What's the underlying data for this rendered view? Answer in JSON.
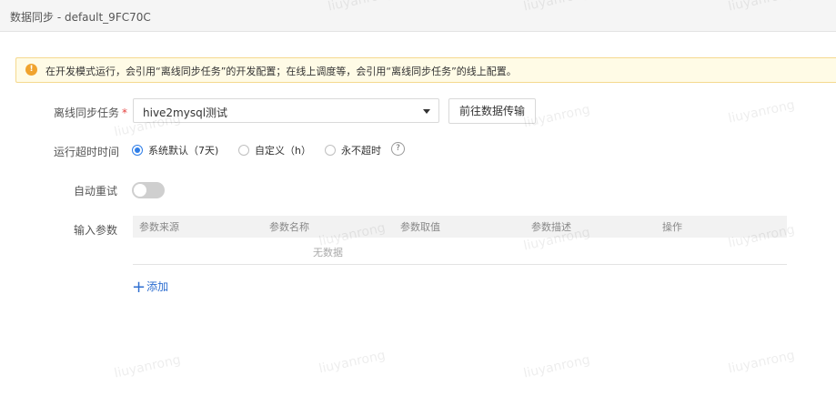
{
  "titlebar": {
    "title": "数据同步 - default_9FC70C"
  },
  "notice": {
    "icon": "warning-icon",
    "text": "在开发模式运行，会引用“离线同步任务”的开发配置；在线上调度等，会引用“离线同步任务”的线上配置。"
  },
  "form": {
    "task": {
      "label": "离线同步任务",
      "required_mark": "*",
      "selected": "hive2mysql测试",
      "goto_button": "前往数据传输"
    },
    "timeout": {
      "label": "运行超时时间",
      "options": [
        {
          "label": "系统默认（7天)",
          "checked": true
        },
        {
          "label": "自定义（h）",
          "checked": false
        },
        {
          "label": "永不超时",
          "checked": false
        }
      ],
      "help": "?"
    },
    "retry": {
      "label": "自动重试",
      "enabled": false
    },
    "params": {
      "label": "输入参数",
      "columns": [
        "参数来源",
        "参数名称",
        "参数取值",
        "参数描述",
        "操作"
      ],
      "empty_text": "无数据",
      "add_label": "添加"
    }
  },
  "watermark": "liuyanrong",
  "colors": {
    "accent": "#2f7ee8",
    "link": "#2f6fd0",
    "warning": "#f0a32e"
  }
}
